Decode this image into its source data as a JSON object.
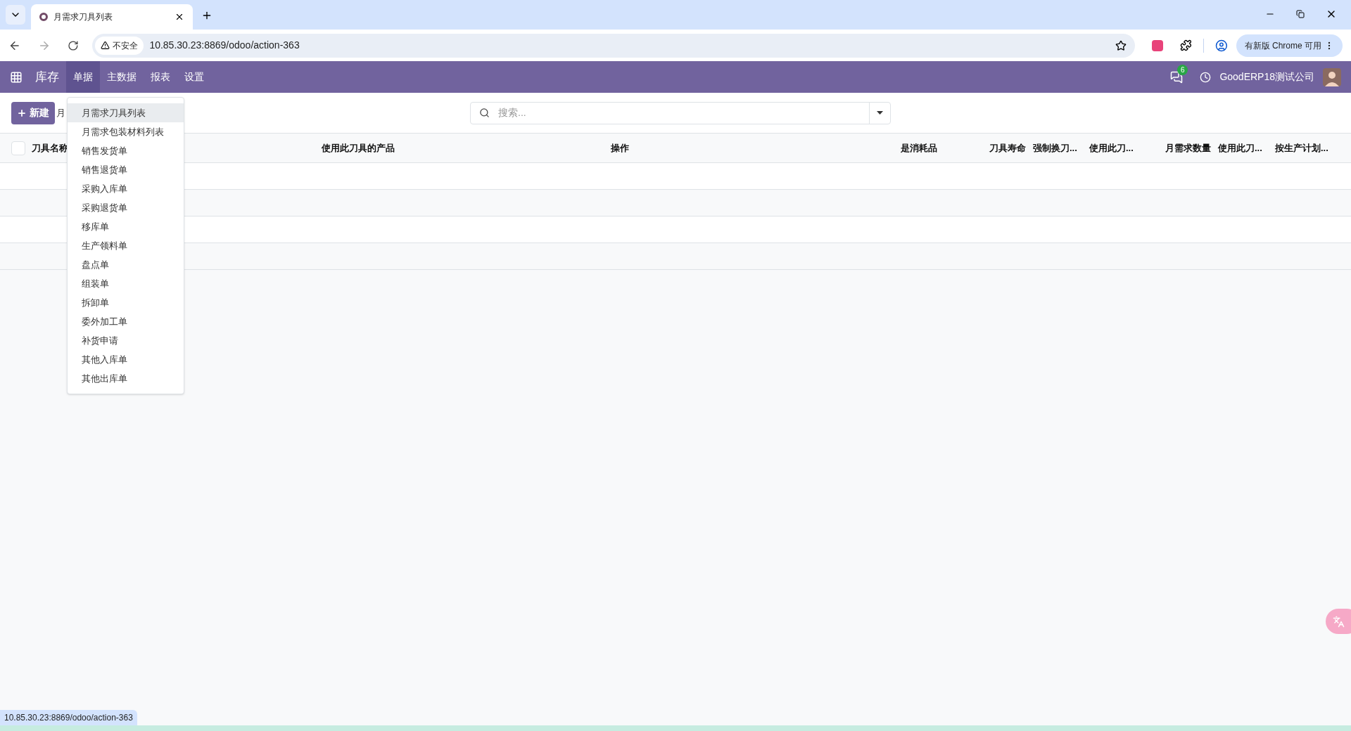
{
  "browser": {
    "tab_title": "月需求刀具列表",
    "security_label": "不安全",
    "url": "10.85.30.23:8869/odoo/action-363",
    "update_button": "有新版 Chrome 可用"
  },
  "navbar": {
    "app_name": "库存",
    "menus": [
      {
        "label": "单据",
        "selected": true
      },
      {
        "label": "主数据",
        "selected": false
      },
      {
        "label": "报表",
        "selected": false
      },
      {
        "label": "设置",
        "selected": false
      }
    ],
    "notification_count": "6",
    "company": "GoodERP18测试公司"
  },
  "control_panel": {
    "new_button": "新建",
    "breadcrumb": "月",
    "search_placeholder": "搜索..."
  },
  "dropdown": {
    "items": [
      {
        "label": "月需求刀具列表",
        "selected": true
      },
      {
        "label": "月需求包装材料列表",
        "selected": false
      },
      {
        "label": "销售发货单",
        "selected": false
      },
      {
        "label": "销售退货单",
        "selected": false
      },
      {
        "label": "采购入库单",
        "selected": false
      },
      {
        "label": "采购退货单",
        "selected": false
      },
      {
        "label": "移库单",
        "selected": false
      },
      {
        "label": "生产领料单",
        "selected": false
      },
      {
        "label": "盘点单",
        "selected": false
      },
      {
        "label": "组装单",
        "selected": false
      },
      {
        "label": "拆卸单",
        "selected": false
      },
      {
        "label": "委外加工单",
        "selected": false
      },
      {
        "label": "补货申请",
        "selected": false
      },
      {
        "label": "其他入库单",
        "selected": false
      },
      {
        "label": "其他出库单",
        "selected": false
      }
    ]
  },
  "table": {
    "select_all_checked": false,
    "columns": [
      "刀具名称",
      "使用此刀具的产品",
      "操作",
      "是消耗品",
      "刀具寿命",
      "强制换刀...",
      "使用此刀...",
      "月需求数量",
      "使用此刀...",
      "按生产计划..."
    ]
  },
  "status_url": "10.85.30.23:8869/odoo/action-363"
}
